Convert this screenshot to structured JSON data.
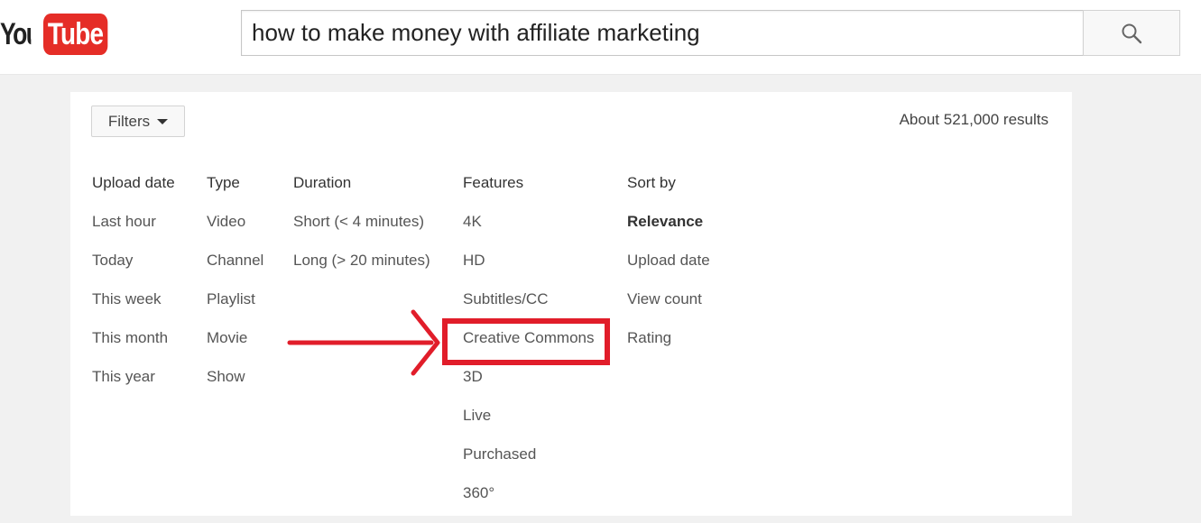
{
  "logo": {
    "left_text": "You",
    "right_text": "Tube",
    "accent_color": "#e52d27"
  },
  "search": {
    "query": "how to make money with affiliate marketing",
    "button_icon": "search-icon"
  },
  "filters": {
    "button_label": "Filters",
    "results_count": "About 521,000 results",
    "columns": [
      {
        "heading": "Upload date",
        "items": [
          "Last hour",
          "Today",
          "This week",
          "This month",
          "This year"
        ]
      },
      {
        "heading": "Type",
        "items": [
          "Video",
          "Channel",
          "Playlist",
          "Movie",
          "Show"
        ]
      },
      {
        "heading": "Duration",
        "items": [
          "Short (< 4 minutes)",
          "Long (> 20 minutes)"
        ]
      },
      {
        "heading": "Features",
        "items": [
          "4K",
          "HD",
          "Subtitles/CC",
          "Creative Commons",
          "3D",
          "Live",
          "Purchased",
          "360°"
        ]
      },
      {
        "heading": "Sort by",
        "items": [
          "Relevance",
          "Upload date",
          "View count",
          "Rating"
        ]
      }
    ]
  },
  "annotation": {
    "color": "#e11d2a",
    "highlighted_item": "Creative Commons"
  }
}
